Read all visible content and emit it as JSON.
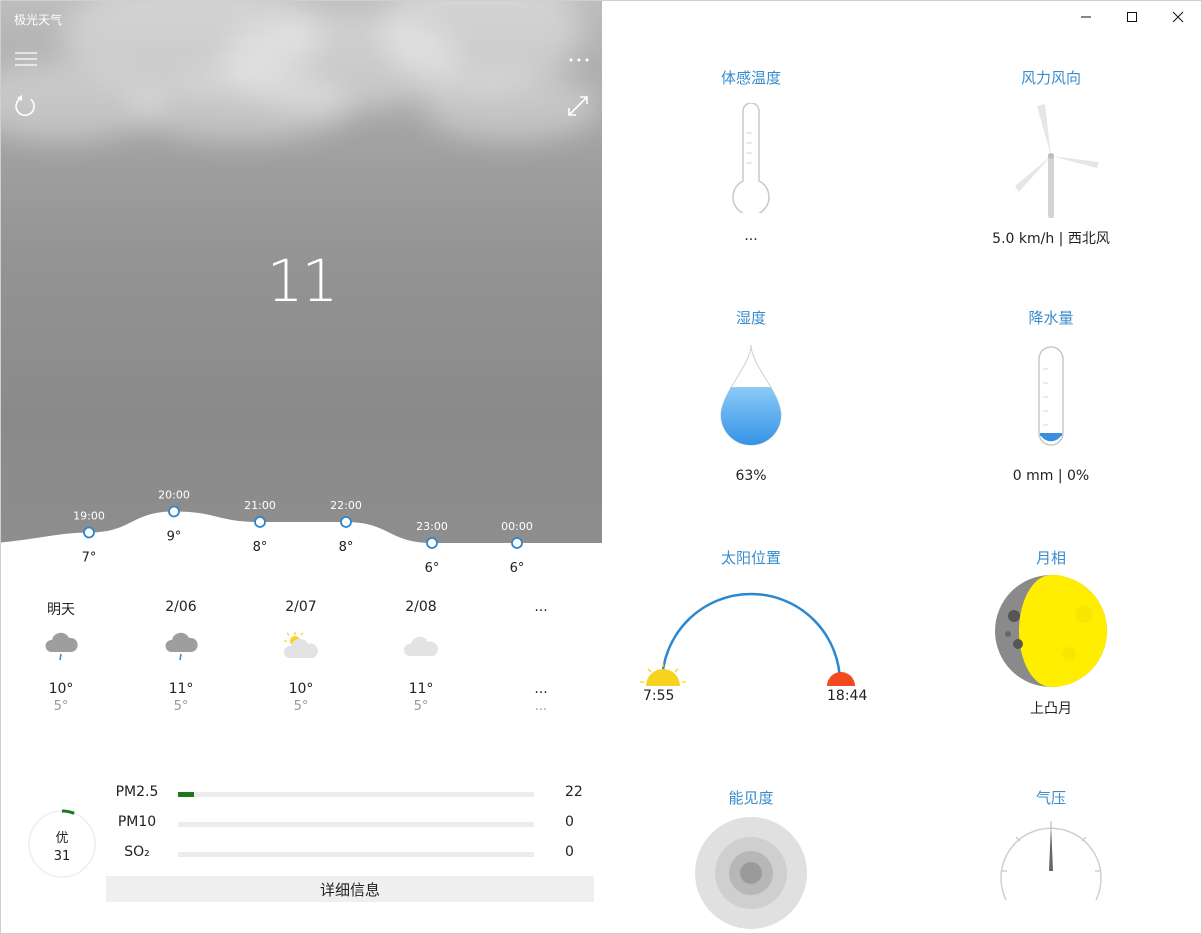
{
  "app": {
    "title": "极光天气"
  },
  "header": {
    "menu_icon": "hamburger-icon",
    "more_icon": "more-icon",
    "refresh_icon": "refresh-icon",
    "expand_icon": "expand-icon"
  },
  "current": {
    "value": "11"
  },
  "hourly": [
    {
      "time": "19:00",
      "temp": "7°",
      "value": 7
    },
    {
      "time": "20:00",
      "temp": "9°",
      "value": 9
    },
    {
      "time": "21:00",
      "temp": "8°",
      "value": 8
    },
    {
      "time": "22:00",
      "temp": "8°",
      "value": 8
    },
    {
      "time": "23:00",
      "temp": "6°",
      "value": 6
    },
    {
      "time": "00:00",
      "temp": "6°",
      "value": 6
    }
  ],
  "daily": [
    {
      "day": "明天",
      "icon": "rain-cloud-icon",
      "high": "10°",
      "low": "5°"
    },
    {
      "day": "2/06",
      "icon": "rain-cloud-icon",
      "high": "11°",
      "low": "5°"
    },
    {
      "day": "2/07",
      "icon": "partly-sunny-icon",
      "high": "10°",
      "low": "5°"
    },
    {
      "day": "2/08",
      "icon": "cloud-icon",
      "high": "11°",
      "low": "5°"
    },
    {
      "day": "...",
      "icon": "",
      "high": "...",
      "low": "..."
    }
  ],
  "aqi": {
    "level": "优",
    "value": "31",
    "items": [
      {
        "label": "PM2.5",
        "value": "22",
        "fraction": 0.045
      },
      {
        "label": "PM10",
        "value": "0",
        "fraction": 0
      },
      {
        "label": "SO₂",
        "value": "0",
        "fraction": 0
      }
    ],
    "detail_button": "详细信息"
  },
  "tiles": {
    "feels_like": {
      "title": "体感温度",
      "value": "..."
    },
    "wind": {
      "title": "风力风向",
      "value": "5.0 km/h | 西北风"
    },
    "humidity": {
      "title": "湿度",
      "value": "63%",
      "fraction": 0.63
    },
    "precip": {
      "title": "降水量",
      "value": "0 mm | 0%"
    },
    "sun": {
      "title": "太阳位置",
      "sunrise": "7:55",
      "sunset": "18:44"
    },
    "moon": {
      "title": "月相",
      "value": "上凸月"
    },
    "visibility": {
      "title": "能见度"
    },
    "pressure": {
      "title": "气压"
    }
  },
  "colors": {
    "accent": "#3a8ccc",
    "aqi_good": "#1a7a1a",
    "sun": "#f7d320",
    "sunset": "#f04a1e",
    "moon": "#ffee00"
  },
  "window": {
    "minimize_icon": "minimize-icon",
    "maximize_icon": "maximize-icon",
    "close_icon": "close-icon"
  }
}
